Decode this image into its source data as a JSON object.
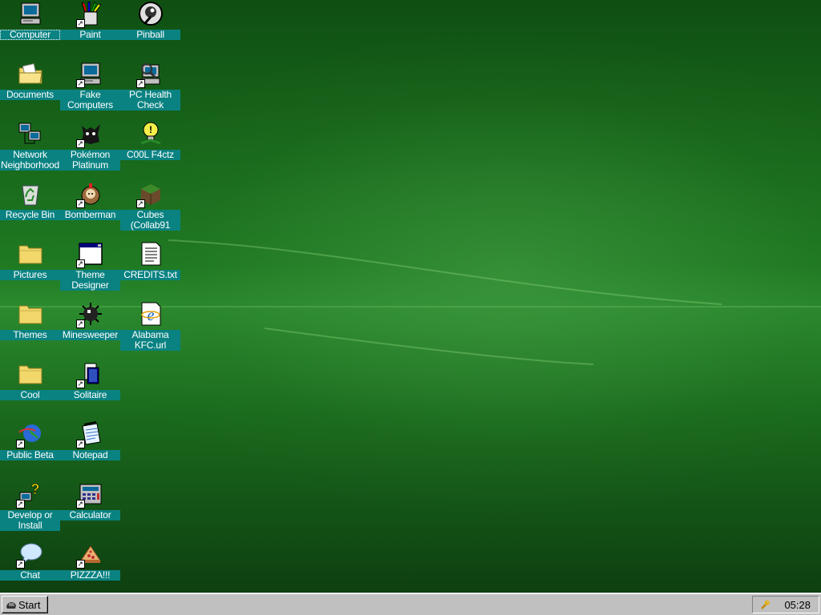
{
  "desktop": {
    "icons": [
      {
        "label": "Computer",
        "icon": "computer-icon",
        "shortcut": false,
        "selected": true
      },
      {
        "label": "Paint",
        "icon": "paint-icon",
        "shortcut": true
      },
      {
        "label": "Pinball",
        "icon": "pinball-icon",
        "shortcut": false
      },
      {
        "label": "Documents",
        "icon": "documents-folder-icon",
        "shortcut": false
      },
      {
        "label": "Fake\nComputers",
        "icon": "computer-icon",
        "shortcut": true
      },
      {
        "label": "PC Health\nCheck",
        "icon": "pc-health-icon",
        "shortcut": true
      },
      {
        "label": "Network\nNeighborhood",
        "icon": "network-icon",
        "shortcut": false
      },
      {
        "label": "Pokémon\nPlatinum",
        "icon": "pokemon-icon",
        "shortcut": true
      },
      {
        "label": "C00L F4ctz",
        "icon": "lightbulb-icon",
        "shortcut": false
      },
      {
        "label": "Recycle Bin",
        "icon": "recycle-bin-icon",
        "shortcut": false
      },
      {
        "label": "Bomberman",
        "icon": "bomberman-icon",
        "shortcut": true
      },
      {
        "label": "Cubes\n(Collab91",
        "icon": "cube-icon",
        "shortcut": true
      },
      {
        "label": "Pictures",
        "icon": "folder-icon",
        "shortcut": false
      },
      {
        "label": "Theme\nDesigner",
        "icon": "window-icon",
        "shortcut": true
      },
      {
        "label": "CREDITS.txt",
        "icon": "text-file-icon",
        "shortcut": false
      },
      {
        "label": "Themes",
        "icon": "folder-icon",
        "shortcut": false
      },
      {
        "label": "Minesweeper",
        "icon": "mine-icon",
        "shortcut": true
      },
      {
        "label": "Alabama\nKFC.url",
        "icon": "internet-shortcut-icon",
        "shortcut": false
      },
      {
        "label": "Cool",
        "icon": "folder-icon",
        "shortcut": false
      },
      {
        "label": "Solitaire",
        "icon": "solitaire-icon",
        "shortcut": true
      },
      {
        "label": "Public Beta",
        "icon": "globe-icon",
        "shortcut": true
      },
      {
        "label": "Notepad",
        "icon": "notepad-icon",
        "shortcut": true
      },
      {
        "label": "Develop or\nInstall",
        "icon": "help-icon",
        "shortcut": true
      },
      {
        "label": "Calculator",
        "icon": "calculator-icon",
        "shortcut": true
      },
      {
        "label": "Chat",
        "icon": "chat-bubble-icon",
        "shortcut": true
      },
      {
        "label": "PIZZZA!!!",
        "icon": "pizza-icon",
        "shortcut": true
      }
    ]
  },
  "taskbar": {
    "start_label": "Start",
    "clock": "05:28"
  },
  "colors": {
    "label_bg": "#0a8282",
    "taskbar": "#c0c0c0",
    "desktop": "#1f7a22"
  }
}
